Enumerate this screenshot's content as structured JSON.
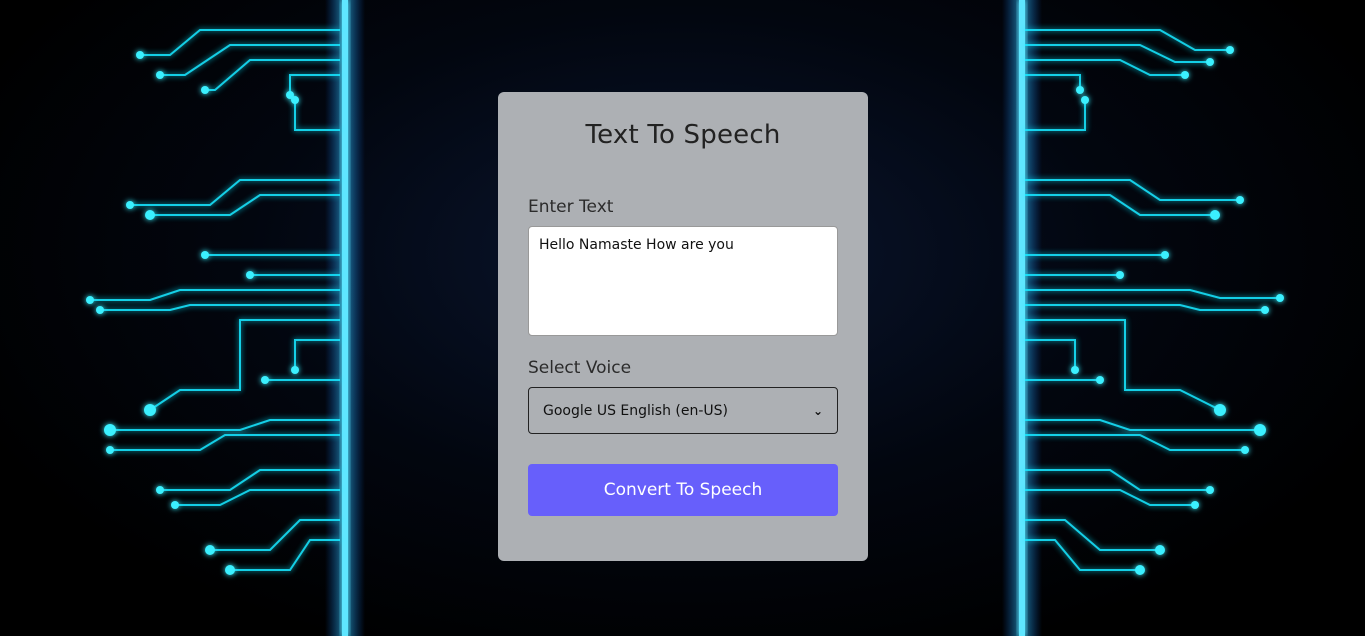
{
  "card": {
    "title": "Text To Speech",
    "text_label": "Enter Text",
    "text_value": "Hello Namaste How are you",
    "voice_label": "Select Voice",
    "voice_selected": "Google US English (en-US)",
    "button_label": "Convert To Speech"
  },
  "colors": {
    "card_bg": "#adb0b4",
    "button_bg": "#675ffb",
    "circuit_glow": "#19e6ff"
  },
  "icons": {
    "select_chevron": "chevron-down-icon"
  }
}
